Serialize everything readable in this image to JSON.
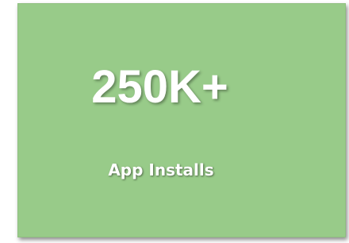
{
  "card": {
    "value": "250K+",
    "label": "App Installs",
    "background_color": "#98cb89",
    "text_color": "#ffffff"
  }
}
